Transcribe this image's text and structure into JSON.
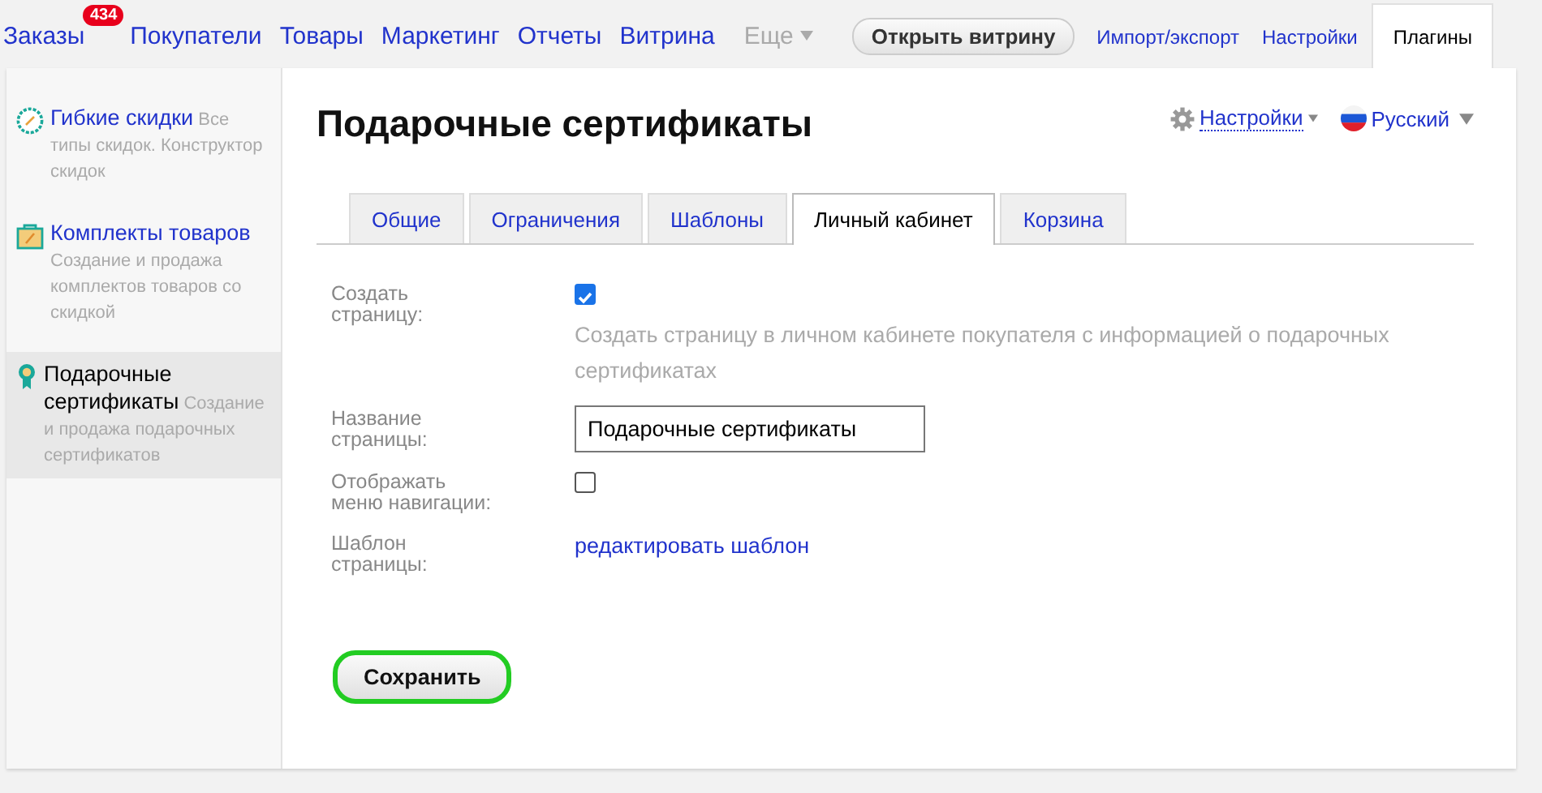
{
  "top_nav": {
    "items": [
      {
        "label": "Заказы",
        "badge": "434"
      },
      {
        "label": "Покупатели"
      },
      {
        "label": "Товары"
      },
      {
        "label": "Маркетинг"
      },
      {
        "label": "Отчеты"
      },
      {
        "label": "Витрина"
      }
    ],
    "more": "Еще",
    "open_storefront": "Открыть витрину",
    "right_items": [
      {
        "label": "Импорт/экспорт",
        "selected": false
      },
      {
        "label": "Настройки",
        "selected": false
      },
      {
        "label": "Плагины",
        "selected": true
      }
    ]
  },
  "sidebar": {
    "items": [
      {
        "title": "Гибкие скидки",
        "description": "Все типы скидок. Конструктор скидок",
        "selected": false
      },
      {
        "title": "Комплекты товаров",
        "description": "Создание и продажа комплектов товаров со скидкой",
        "selected": false
      },
      {
        "title": "Подарочные сертификаты",
        "description": "Создание и продажа подарочных сертификатов",
        "selected": true
      }
    ]
  },
  "page": {
    "title": "Подарочные сертификаты",
    "settings_link": "Настройки",
    "language": "Русский",
    "tabs": [
      {
        "label": "Общие",
        "selected": false
      },
      {
        "label": "Ограничения",
        "selected": false
      },
      {
        "label": "Шаблоны",
        "selected": false
      },
      {
        "label": "Личный кабинет",
        "selected": true
      },
      {
        "label": "Корзина",
        "selected": false
      }
    ],
    "form": [
      {
        "kind": "checkbox",
        "label": "Создать страницу:",
        "checked": true,
        "hint": "Создать страницу в личном кабинете покупателя с информацией о подарочных сертификатах"
      },
      {
        "kind": "text",
        "label": "Название страницы:",
        "value": "Подарочные сертификаты"
      },
      {
        "kind": "checkbox",
        "label": "Отображать меню навигации:",
        "checked": false
      },
      {
        "kind": "link",
        "label": "Шаблон страницы:",
        "link": "редактировать шаблон"
      }
    ],
    "save_button": "Сохранить"
  }
}
